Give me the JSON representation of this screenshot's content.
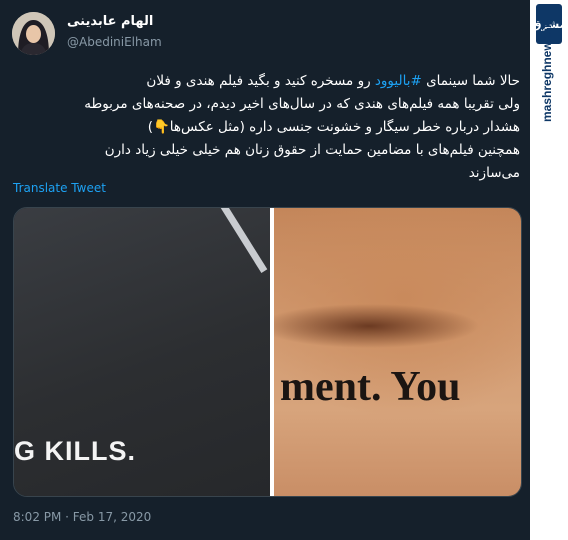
{
  "user": {
    "display_name": "الهام عابدینی",
    "handle": "@AbediniElham"
  },
  "tweet": {
    "line1_pre": "حالا شما سینمای ",
    "hashtag": "#بالیوود",
    "line1_post": " رو مسخره کنید و بگید فیلم هندی و فلان",
    "line2": "ولی تقریبا همه فیلم‌های هندی که در سال‌های اخیر دیدم، در صحنه‌های مربوطه",
    "line3": "هشدار درباره خطر سیگار و خشونت جنسی داره (مثل عکس‌ها👇)",
    "line4": "همچنین فیلم‌های با مضامین حمایت از حقوق زنان هم خیلی خیلی زیاد دارن",
    "line5": "می‌سازند",
    "translate_label": "Translate Tweet",
    "timestamp": "8:02 PM · Feb 17, 2020"
  },
  "media": {
    "left_caption": "G KILLS.",
    "right_caption": "ment. You"
  },
  "watermark": {
    "logo_text": "مشرق",
    "site": "mashreghnews.ir"
  },
  "colors": {
    "background": "#15202b",
    "accent": "#1da1f2",
    "muted": "#8899a6"
  }
}
